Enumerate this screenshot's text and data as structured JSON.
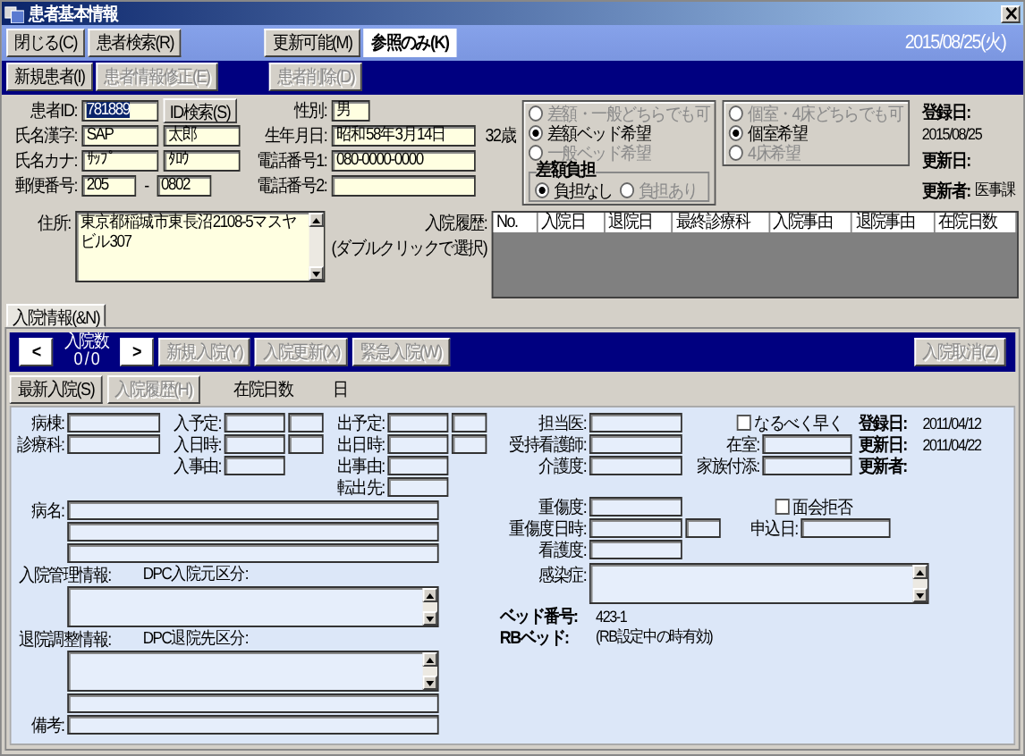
{
  "window": {
    "title": "患者基本情報"
  },
  "toolbar": {
    "buttons": [
      {
        "label": "閉じる(C)",
        "disabled": false
      },
      {
        "label": "患者検索(R)",
        "disabled": false
      }
    ],
    "modes": [
      {
        "label": "更新可能(M)",
        "selected": false
      },
      {
        "label": "参照のみ(K)",
        "selected": true
      }
    ],
    "date": "2015/08/25(火)"
  },
  "actions": [
    {
      "label": "新規患者(I)",
      "disabled": false
    },
    {
      "label": "患者情報修正(E)",
      "disabled": true
    },
    {
      "label": "患者削除(D)",
      "disabled": true
    }
  ],
  "patient": {
    "id": {
      "label": "患者ID:",
      "value": "781889",
      "highlighted": true,
      "button": "ID検索(S)"
    },
    "name_kanji": {
      "label": "氏名漢字:",
      "values": [
        "SAP",
        "太郎"
      ]
    },
    "name_kana": {
      "label": "氏名カナ:",
      "values": [
        "ｻｯﾌﾟ",
        "ﾀﾛｳ"
      ]
    },
    "postal": {
      "label": "郵便番号:",
      "values": [
        "205",
        "0802"
      ],
      "separator": "-"
    },
    "sex": {
      "label": "性別:",
      "value": "男"
    },
    "birth": {
      "label": "生年月日:",
      "value": "昭和58年3月14日",
      "age": "32歳"
    },
    "phone1": {
      "label": "電話番号1:",
      "value": "080-0000-0000"
    },
    "phone2": {
      "label": "電話番号2:"
    },
    "address": {
      "label": "住所:",
      "value": "東京都稲城市東長沼2108-5マスヤビル307"
    }
  },
  "bed_options": [
    {
      "options": [
        {
          "label": "差額・一般どちらでも可",
          "selected": false,
          "disabled": true
        },
        {
          "label": "差額ベッド希望",
          "selected": true,
          "disabled": false
        },
        {
          "label": "一般ベッド希望",
          "selected": false,
          "disabled": true
        }
      ],
      "burden": {
        "title": "差額負担",
        "options": [
          {
            "label": "負担なし",
            "selected": true,
            "disabled": false
          },
          {
            "label": "負担あり",
            "selected": false,
            "disabled": true
          }
        ]
      }
    },
    {
      "options": [
        {
          "label": "個室・4床どちらでも可",
          "selected": false,
          "disabled": true
        },
        {
          "label": "個室希望",
          "selected": true,
          "disabled": false
        },
        {
          "label": "4床希望",
          "selected": false,
          "disabled": true
        }
      ]
    }
  ],
  "registration": [
    {
      "label": "登録日:",
      "value": "2015/08/25"
    },
    {
      "label": "更新日:"
    },
    {
      "label": "更新者:",
      "value": "医事課"
    }
  ],
  "history": {
    "label": "入院履歴:",
    "hint": "(ダブルクリックで選択)",
    "columns": [
      "No.",
      "入院日",
      "退院日",
      "最終診療科",
      "入院事由",
      "退院事由",
      "在院日数"
    ]
  },
  "tabs": [
    {
      "label": "入院情報(&N)",
      "selected": true
    }
  ],
  "admission_bar": {
    "prev": "<",
    "next": ">",
    "count_label": "入院数",
    "count": "0 / 0",
    "buttons": [
      {
        "label": "新規入院(Y)",
        "disabled": true
      },
      {
        "label": "入院更新(X)",
        "disabled": true
      },
      {
        "label": "緊急入院(W)",
        "disabled": true
      }
    ],
    "cancel": {
      "label": "入院取消(Z)",
      "disabled": true
    }
  },
  "subtabs": [
    {
      "label": "最新入院(S)",
      "disabled": false
    },
    {
      "label": "入院履歴(H)",
      "disabled": true
    }
  ],
  "stay": {
    "label": "在院日数",
    "unit": "日"
  },
  "form": {
    "left": [
      {
        "columns": [
          [
            {
              "kind": "single",
              "label": "病棟:"
            },
            {
              "kind": "single",
              "label": "診療科:"
            }
          ],
          [
            {
              "kind": "pair",
              "label": "入予定:"
            },
            {
              "kind": "pair",
              "label": "入日時:"
            },
            {
              "kind": "single",
              "label": "入事由:"
            }
          ],
          [
            {
              "kind": "pair",
              "label": "出予定:"
            },
            {
              "kind": "pair",
              "label": "出日時:"
            },
            {
              "kind": "single",
              "label": "出事由:"
            },
            {
              "kind": "single",
              "label": "転出先:"
            }
          ]
        ]
      },
      {
        "columns": [
          [
            {
              "kind": "single",
              "label": "病名:"
            },
            {
              "kind": "single"
            },
            {
              "kind": "single"
            },
            {
              "kind": "heading",
              "label": "入院管理情報:",
              "note": "DPC入院元区分:"
            },
            {
              "kind": "textarea"
            },
            {
              "kind": "heading",
              "label": "退院調整情報:",
              "note": "DPC退院先区分:"
            },
            {
              "kind": "textarea"
            },
            {
              "kind": "single"
            },
            {
              "kind": "single",
              "label": "備考:"
            }
          ]
        ]
      }
    ],
    "right": [
      {
        "columns": [
          [
            {
              "kind": "single",
              "label": "担当医:"
            },
            {
              "kind": "single",
              "label": "受持看護師:"
            },
            {
              "kind": "single",
              "label": "介護度:"
            }
          ],
          [
            {
              "kind": "checkbox",
              "label": "なるべく早く",
              "checked": false
            },
            {
              "kind": "single",
              "label": "在室:"
            },
            {
              "kind": "single",
              "label": "家族付添:"
            }
          ],
          [
            {
              "kind": "info",
              "label": "登録日:",
              "value": "2011/04/12"
            },
            {
              "kind": "info",
              "label": "更新日:",
              "value": "2011/04/22"
            },
            {
              "kind": "info",
              "label": "更新者:"
            }
          ]
        ]
      },
      {
        "columns": [
          [
            {
              "kind": "single",
              "label": "重傷度:"
            },
            {
              "kind": "pair",
              "label": "重傷度日時:"
            },
            {
              "kind": "single",
              "label": "看護度:"
            }
          ],
          [
            {
              "kind": "checkbox",
              "label": "面会拒否",
              "checked": false
            },
            {
              "kind": "single",
              "label": "申込日:"
            }
          ]
        ]
      },
      {
        "columns": [
          [
            {
              "kind": "textarea",
              "label": "感染症:"
            },
            {
              "kind": "info",
              "label": "ベッド番号:",
              "value": "423-1"
            },
            {
              "kind": "info",
              "label": "RBベッド:",
              "value": "(RB設定中の時有効)"
            }
          ]
        ]
      }
    ]
  }
}
